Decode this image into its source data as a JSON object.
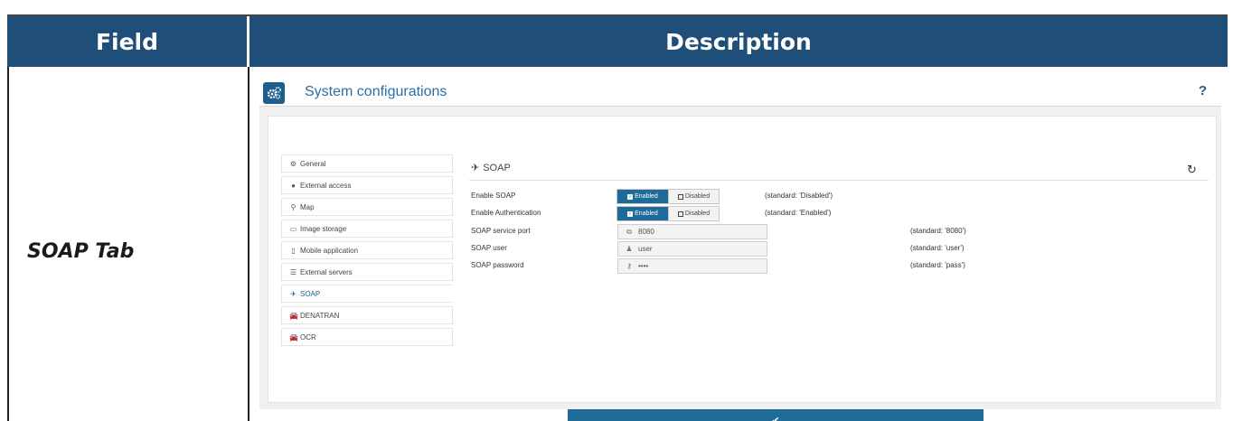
{
  "table": {
    "header_field": "Field",
    "header_description": "Description",
    "row_label": "SOAP Tab"
  },
  "screen": {
    "title": "System configurations",
    "help": "?",
    "menu": [
      {
        "icon": "gears-icon",
        "glyph": "⚙",
        "label": "General"
      },
      {
        "icon": "globe-icon",
        "glyph": "●",
        "label": "External access"
      },
      {
        "icon": "map-marker-icon",
        "glyph": "⚲",
        "label": "Map"
      },
      {
        "icon": "hard-drive-icon",
        "glyph": "▭",
        "label": "Image storage"
      },
      {
        "icon": "mobile-icon",
        "glyph": "▯",
        "label": "Mobile application"
      },
      {
        "icon": "server-icon",
        "glyph": "☰",
        "label": "External servers"
      },
      {
        "icon": "paper-plane-icon",
        "glyph": "✈",
        "label": "SOAP"
      },
      {
        "icon": "car-icon",
        "glyph": "🚘",
        "label": "DENATRAN"
      },
      {
        "icon": "car-icon",
        "glyph": "🚘",
        "label": "OCR"
      }
    ],
    "section": {
      "title": "SOAP",
      "rows": {
        "enable_soap": {
          "label": "Enable SOAP",
          "on": "Enabled",
          "off": "Disabled",
          "standard": "(standard: 'Disabled')"
        },
        "enable_auth": {
          "label": "Enable Authentication",
          "on": "Enabled",
          "off": "Disabled",
          "standard": "(standard: 'Enabled')"
        },
        "port": {
          "label": "SOAP service port",
          "value": "8080",
          "standard": "(standard: '8080')"
        },
        "user": {
          "label": "SOAP user",
          "value": "user",
          "standard": "(standard: 'user')"
        },
        "password": {
          "label": "SOAP password",
          "value": "••••",
          "standard": "(standard: 'pass')"
        }
      }
    },
    "save_icon": "✔",
    "colors": {
      "header": "#1f4e79",
      "accent": "#1e6a99",
      "title": "#2a6fa3"
    }
  }
}
